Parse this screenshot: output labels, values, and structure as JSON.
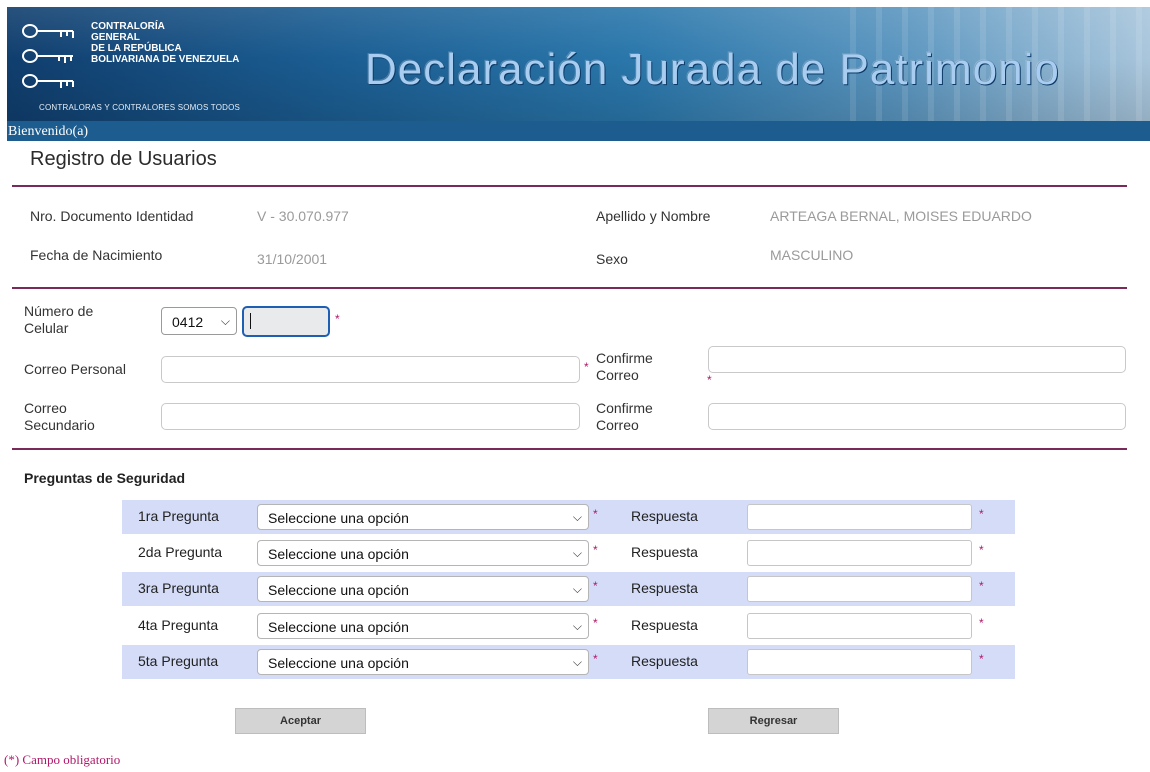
{
  "header": {
    "logo_lines": [
      "CONTRALORÍA",
      "GENERAL",
      "DE LA REPÚBLICA",
      "BOLIVARIANA DE VENEZUELA"
    ],
    "slogan": "CONTRALORAS Y CONTRALORES SOMOS TODOS",
    "title": "Declaración Jurada de Patrimonio",
    "welcome": "Bienvenido(a)"
  },
  "page_title": "Registro de Usuarios",
  "personal": {
    "doc_label": "Nro. Documento Identidad",
    "doc_value": "V - 30.070.977",
    "name_label": "Apellido y Nombre",
    "name_value": "ARTEAGA BERNAL, MOISES EDUARDO",
    "birth_label": "Fecha de Nacimiento",
    "birth_value": "31/10/2001",
    "sex_label": "Sexo",
    "sex_value": "MASCULINO"
  },
  "contact": {
    "cell_label_1": "Número de",
    "cell_label_2": "Celular",
    "cell_prefix": "0412",
    "cell_value": "",
    "email_label": "Correo Personal",
    "email_value": "",
    "confirm_label_1": "Confirme",
    "confirm_label_2": "Correo",
    "confirm_value": "",
    "email2_label_1": "Correo",
    "email2_label_2": "Secundario",
    "email2_value": "",
    "confirm2_label_1": "Confirme",
    "confirm2_label_2": "Correo",
    "confirm2_value": ""
  },
  "required_mark": "*",
  "security": {
    "heading": "Preguntas de Seguridad",
    "answer_label": "Respuesta",
    "questions": [
      {
        "label": "1ra Pregunta",
        "selected": "Seleccione una opción",
        "answer": ""
      },
      {
        "label": "2da Pregunta",
        "selected": "Seleccione una opción",
        "answer": ""
      },
      {
        "label": "3ra Pregunta",
        "selected": "Seleccione una opción",
        "answer": ""
      },
      {
        "label": "4ta Pregunta",
        "selected": "Seleccione una opción",
        "answer": ""
      },
      {
        "label": "5ta Pregunta",
        "selected": "Seleccione una opción",
        "answer": ""
      }
    ]
  },
  "buttons": {
    "accept": "Aceptar",
    "back": "Regresar"
  },
  "footnote": "(*) Campo obligatorio",
  "icons": {
    "chevron": "chevron-down-icon",
    "logo": "keys-logo-icon"
  },
  "colors": {
    "banner": "#1b5d92",
    "rule": "#7a2a5a",
    "required": "#b0186a",
    "row_shade": "#d4dcf7",
    "focus": "#1e5fb4"
  }
}
